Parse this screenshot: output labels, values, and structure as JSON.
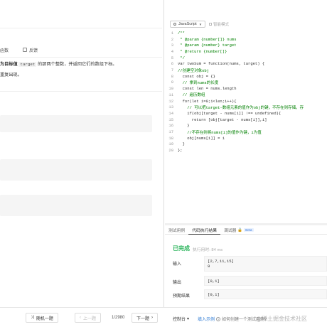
{
  "left": {
    "tabs": [
      "函数",
      "反馈"
    ],
    "description_p1_start": "为目标值",
    "description_code": "target",
    "description_p1_end": "的那两个整数，并返回它们的数组下标。",
    "description_p2": "重复出现。"
  },
  "editor": {
    "language": "JavaScript",
    "mode_label": "智能模式"
  },
  "code_lines": [
    {
      "n": "1",
      "t": "/**",
      "cls": "c-cm"
    },
    {
      "n": "2",
      "t": " * @param {number[]} nums",
      "cls": "c-cm"
    },
    {
      "n": "3",
      "t": " * @param {number} target",
      "cls": "c-cm"
    },
    {
      "n": "4",
      "t": " * @return {number[]}",
      "cls": "c-cm"
    },
    {
      "n": "5",
      "t": " */",
      "cls": "c-cm"
    },
    {
      "n": "6",
      "t": "var twoSum = function(nums, target) {",
      "cls": "ct"
    },
    {
      "n": "7",
      "t": "//创建空对象obj",
      "cls": "c-cm"
    },
    {
      "n": "8",
      "t": "  const obj = {}",
      "cls": "ct"
    },
    {
      "n": "9",
      "t": "  // 拿到nums的长度",
      "cls": "c-cm"
    },
    {
      "n": "10",
      "t": "  const len = nums.length",
      "cls": "ct"
    },
    {
      "n": "11",
      "t": "  // 遍历数组",
      "cls": "c-cm"
    },
    {
      "n": "12",
      "t": "  for(let i=0;i<len;i++){",
      "cls": "ct"
    },
    {
      "n": "13",
      "t": "    // 可以把target-数组元素的值作为obj的键，不存在则存储，存",
      "cls": "c-cm"
    },
    {
      "n": "14",
      "t": "    if(obj[target - nums[i]] !== undefined){",
      "cls": "ct"
    },
    {
      "n": "15",
      "t": "      return [obj[target - nums[i]],i]",
      "cls": "ct"
    },
    {
      "n": "16",
      "t": "    }",
      "cls": "ct"
    },
    {
      "n": "17",
      "t": "    //不存在则将nums[i]的值作为键，i为值",
      "cls": "c-cm"
    },
    {
      "n": "18",
      "t": "    obj[nums[i]] = i",
      "cls": "ct"
    },
    {
      "n": "19",
      "t": "  }",
      "cls": "ct"
    },
    {
      "n": "20",
      "t": "};",
      "cls": "ct"
    }
  ],
  "console": {
    "tabs": [
      "测试用例",
      "代码执行结果",
      "调试器"
    ],
    "beta_badge": "Beta",
    "status": "已完成",
    "exec_time": "执行用时: 84 ms",
    "input_label": "输入",
    "input_line1": "[2,7,11,15]",
    "input_line2": "9",
    "output_label": "输出",
    "output_value": "[0,1]",
    "expected_label": "预期结果",
    "expected_value": "[0,1]"
  },
  "bottom": {
    "random_label": "随机一题",
    "prev_label": "上一题",
    "page": "1/2980",
    "next_label": "下一题",
    "console_label": "控制台",
    "example_label": "填入示例",
    "hint_label": "如何创建一个测试用例?",
    "watermark": "@稀土掘金技术社区"
  }
}
